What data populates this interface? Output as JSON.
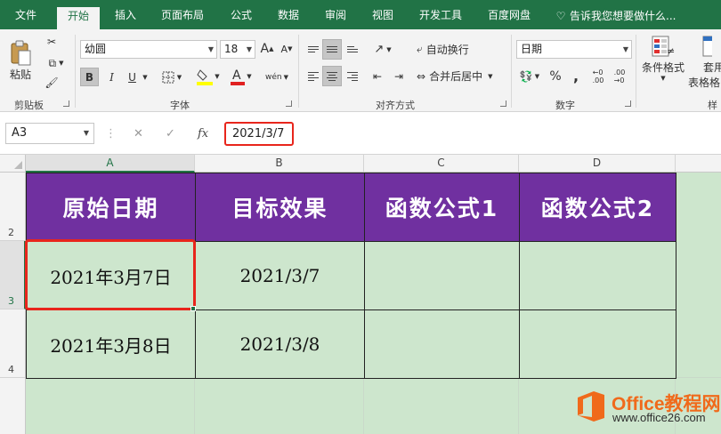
{
  "ribbon_tabs": [
    "文件",
    "开始",
    "插入",
    "页面布局",
    "公式",
    "数据",
    "审阅",
    "视图",
    "开发工具",
    "百度网盘"
  ],
  "tell_me": "告诉我您想要做什么...",
  "clipboard": {
    "paste_label": "粘贴",
    "group_label": "剪贴板"
  },
  "font": {
    "name": "幼圆",
    "size": "18",
    "bold": "B",
    "italic": "I",
    "underline": "U",
    "grow": "A",
    "shrink": "A",
    "phonetic": "wén",
    "group_label": "字体"
  },
  "alignment": {
    "wrap_text": "自动换行",
    "merge_center": "合并后居中",
    "group_label": "对齐方式"
  },
  "number": {
    "format": "日期",
    "percent": "%",
    "comma": ",",
    "group_label": "数字"
  },
  "styles": {
    "conditional_format": "条件格式",
    "table_format_1": "套用",
    "table_format_2": "表格格",
    "group_label": "样"
  },
  "formula_bar": {
    "name_box": "A3",
    "cancel": "✕",
    "enter": "✓",
    "fx": "fx",
    "formula": "2021/3/7"
  },
  "columns": [
    "A",
    "B",
    "C",
    "D"
  ],
  "rows": [
    "2",
    "3",
    "4"
  ],
  "table": {
    "headers": [
      "原始日期",
      "目标效果",
      "函数公式1",
      "函数公式2"
    ],
    "rows": [
      [
        "2021年3月7日",
        "2021/3/7",
        "",
        ""
      ],
      [
        "2021年3月8日",
        "2021/3/8",
        "",
        ""
      ]
    ]
  },
  "colors": {
    "excel_green": "#217346",
    "header_purple": "#7030a0",
    "cell_green": "#cde6cd",
    "highlight_red": "#e8251c"
  },
  "watermark": {
    "brand": "Office教程网",
    "url": "www.office26.com"
  }
}
